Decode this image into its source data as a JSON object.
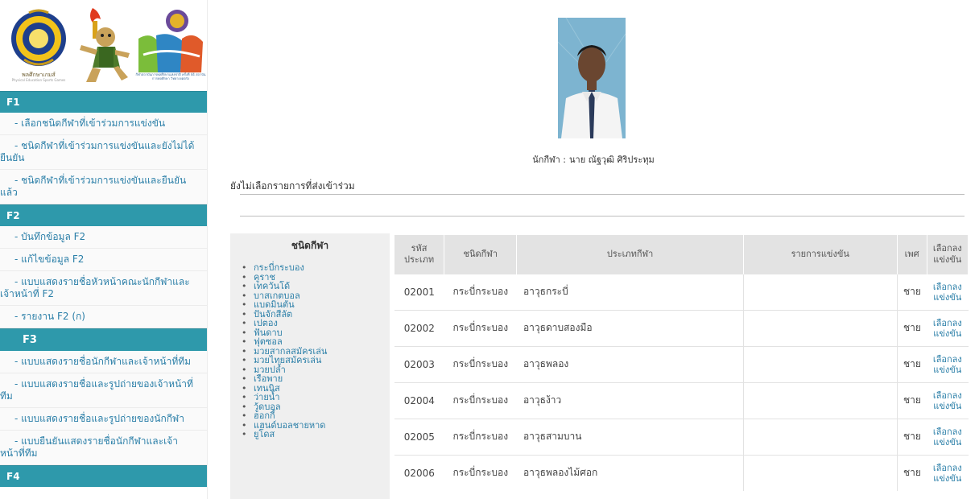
{
  "logos": {
    "caption_main": "พลศึกษาเกมส์",
    "caption_sub": "Physical Education Sports Games",
    "caption_right": "กีฬาสถาบันการพลศึกษาแห่งชาติ ครั้งที่ 44 สถาบันการพลศึกษา วิทยาเขตตรัง"
  },
  "sidebar": {
    "sections": [
      {
        "header": "F1",
        "items": [
          "- เลือกชนิดกีฬาที่เข้าร่วมการแข่งขัน",
          "- ชนิดกีฬาที่เข้าร่วมการแข่งขันและยังไม่ได้ยืนยัน",
          "- ชนิดกีฬาที่เข้าร่วมการแข่งขันและยืนยันแล้ว"
        ]
      },
      {
        "header": "F2",
        "items": [
          "- บันทึกข้อมูล F2",
          "- แก้ไขข้อมูล F2",
          "- แบบแสดงรายชื่อหัวหน้าคณะนักกีฬาและเจ้าหน้าที่ F2",
          "- รายงาน F2 (ก)"
        ]
      },
      {
        "header": "F3",
        "items": [
          "- แบบแสดงรายชื่อนักกีฬาและเจ้าหน้าที่ทีม",
          "- แบบแสดงรายชื่อและรูปถ่ายของเจ้าหน้าที่ทีม",
          "- แบบแสดงรายชื่อและรูปถ่ายของนักกีฬา",
          "- แบบยืนยันแสดงรายชื่อนักกีฬาและเจ้าหน้าที่ทีม"
        ]
      },
      {
        "header": "F4",
        "items": []
      }
    ]
  },
  "athlete": {
    "label": "นักกีฬา :",
    "name": "นาย ณัฐวุฒิ ศิริประทุม"
  },
  "status": {
    "not_selected": "ยังไม่เลือกรายการที่ส่งเข้าร่วม"
  },
  "categories": {
    "title": "ชนิดกีฬา",
    "items": [
      "กระบี่กระบอง",
      "คูราช",
      "เทควันโด้",
      "บาสเกตบอล",
      "แบดมินตัน",
      "ปันจักสีลัต",
      "เปตอง",
      "ฟันดาบ",
      "ฟุตซอล",
      "มวยสากลสมัครเล่น",
      "มวยไทยสมัครเล่น",
      "มวยปล้ำ",
      "เรือพาย",
      "เทนนิส",
      "ว่ายน้ำ",
      "วู้ดบอล",
      "ฮอกกี้",
      "แฮนด์บอลชายหาด",
      "ยูโดส"
    ]
  },
  "table": {
    "headers": {
      "code": "รหัส ประเภท",
      "sport": "ชนิดกีฬา",
      "type": "ประเภทกีฬา",
      "event": "รายการแข่งขัน",
      "sex": "เพศ",
      "select": "เลือกลง แข่งขัน"
    },
    "rows": [
      {
        "code": "02001",
        "sport": "กระบี่กระบอง",
        "type": "อาวุธกระบี่",
        "event": "",
        "sex": "ชาย",
        "select": "เลือกลง แข่งขัน"
      },
      {
        "code": "02002",
        "sport": "กระบี่กระบอง",
        "type": "อาวุธดาบสองมือ",
        "event": "",
        "sex": "ชาย",
        "select": "เลือกลง แข่งขัน"
      },
      {
        "code": "02003",
        "sport": "กระบี่กระบอง",
        "type": "อาวุธพลอง",
        "event": "",
        "sex": "ชาย",
        "select": "เลือกลง แข่งขัน"
      },
      {
        "code": "02004",
        "sport": "กระบี่กระบอง",
        "type": "อาวุธง้าว",
        "event": "",
        "sex": "ชาย",
        "select": "เลือกลง แข่งขัน"
      },
      {
        "code": "02005",
        "sport": "กระบี่กระบอง",
        "type": "อาวุธสามบาน",
        "event": "",
        "sex": "ชาย",
        "select": "เลือกลง แข่งขัน"
      },
      {
        "code": "02006",
        "sport": "กระบี่กระบอง",
        "type": "อาวุธพลองไม้ศอก",
        "event": "",
        "sex": "ชาย",
        "select": "เลือกลง แข่งขัน"
      }
    ]
  },
  "colors": {
    "section_header": "#2e99ab",
    "link": "#2b7fa8",
    "table_header_bg": "#e3e3e3",
    "category_panel_bg": "#efefef"
  }
}
